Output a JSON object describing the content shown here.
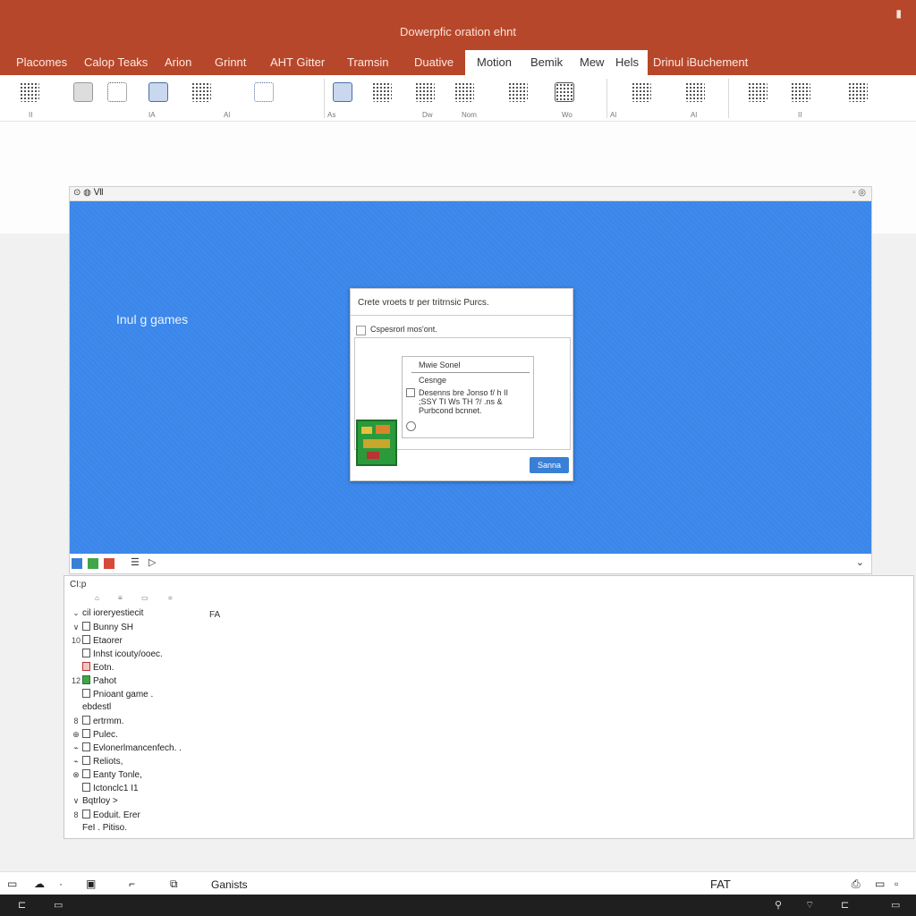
{
  "window": {
    "title": "Dowerpfic oration ehnt"
  },
  "ribbon": {
    "tabs": [
      {
        "label": "Placomes"
      },
      {
        "label": "Calop Teaks"
      },
      {
        "label": "Arion"
      },
      {
        "label": "Grinnt"
      },
      {
        "label": "AHT Gitter"
      },
      {
        "label": "Tramsin"
      },
      {
        "label": "Duative"
      },
      {
        "label": "Motion"
      },
      {
        "label": "Bemik"
      },
      {
        "label": "Mew"
      },
      {
        "label": "Hels"
      },
      {
        "label": "Drinul iBuchement"
      }
    ],
    "small_labels": [
      "II",
      "IA",
      "Al",
      "As",
      "Dw",
      "Nom",
      "Wo",
      "Al",
      "Al",
      "II"
    ]
  },
  "embedded": {
    "header_left": "⊙ ◍ Ⅶ",
    "header_right": "▫ ◎",
    "caption": "Inul g games",
    "swatch_colors": [
      "#3a7fd6",
      "#3fa64a",
      "#d64a3a"
    ],
    "footer_right": "⌄"
  },
  "dialog": {
    "title": "Crete vroets tr per tritrnsic Purcs.",
    "checkbox_label": "Cspesrorl mos'ont.",
    "inner_title": "Mwie Sonel",
    "inner_sub": "Cesnge",
    "inner_desc": "Desenns bre Jonso f/ h II ;SSY TI Ws TH ?/ .ns & Purbcond bcnnet.",
    "button": "Sanna"
  },
  "tree": {
    "header": "CI:p",
    "tools": [
      "⌂",
      "≡",
      "▭",
      "="
    ],
    "tag": "FA",
    "rows": [
      {
        "twisty": "⌄",
        "icon": "none",
        "label": "cil ioreryestiecit"
      },
      {
        "twisty": "∨",
        "icon": "box",
        "label": "Bunny SH"
      },
      {
        "twisty": "10",
        "icon": "box",
        "label": "Etaorer"
      },
      {
        "twisty": "",
        "icon": "box",
        "label": "Inhst icouty/ooec."
      },
      {
        "twisty": "",
        "icon": "red",
        "label": "Eotn."
      },
      {
        "twisty": "12",
        "icon": "green",
        "label": "Pahot"
      },
      {
        "twisty": "",
        "icon": "box",
        "label": "Pnioant game ."
      },
      {
        "twisty": "",
        "icon": "none",
        "label": "ebdestl"
      },
      {
        "twisty": "8",
        "icon": "box",
        "label": "ertrmm."
      },
      {
        "twisty": "⊕",
        "icon": "box",
        "label": "Pulec."
      },
      {
        "twisty": "⌁",
        "icon": "box",
        "label": "Evlonerlmancenfech. ."
      },
      {
        "twisty": "⌁",
        "icon": "box",
        "label": "Reliots,"
      },
      {
        "twisty": "⊗",
        "icon": "box",
        "label": "Eanty Tonle,"
      },
      {
        "twisty": "",
        "icon": "box",
        "label": "Ictonclc1 I1"
      },
      {
        "twisty": "∨",
        "icon": "none",
        "label": "Bqtrloy >"
      },
      {
        "twisty": "8",
        "icon": "box",
        "label": "Eoduit. Erer"
      },
      {
        "twisty": "",
        "icon": "none",
        "label": "FeI . Pitiso."
      }
    ]
  },
  "status": {
    "text": "Ganists",
    "right": "FAT"
  }
}
